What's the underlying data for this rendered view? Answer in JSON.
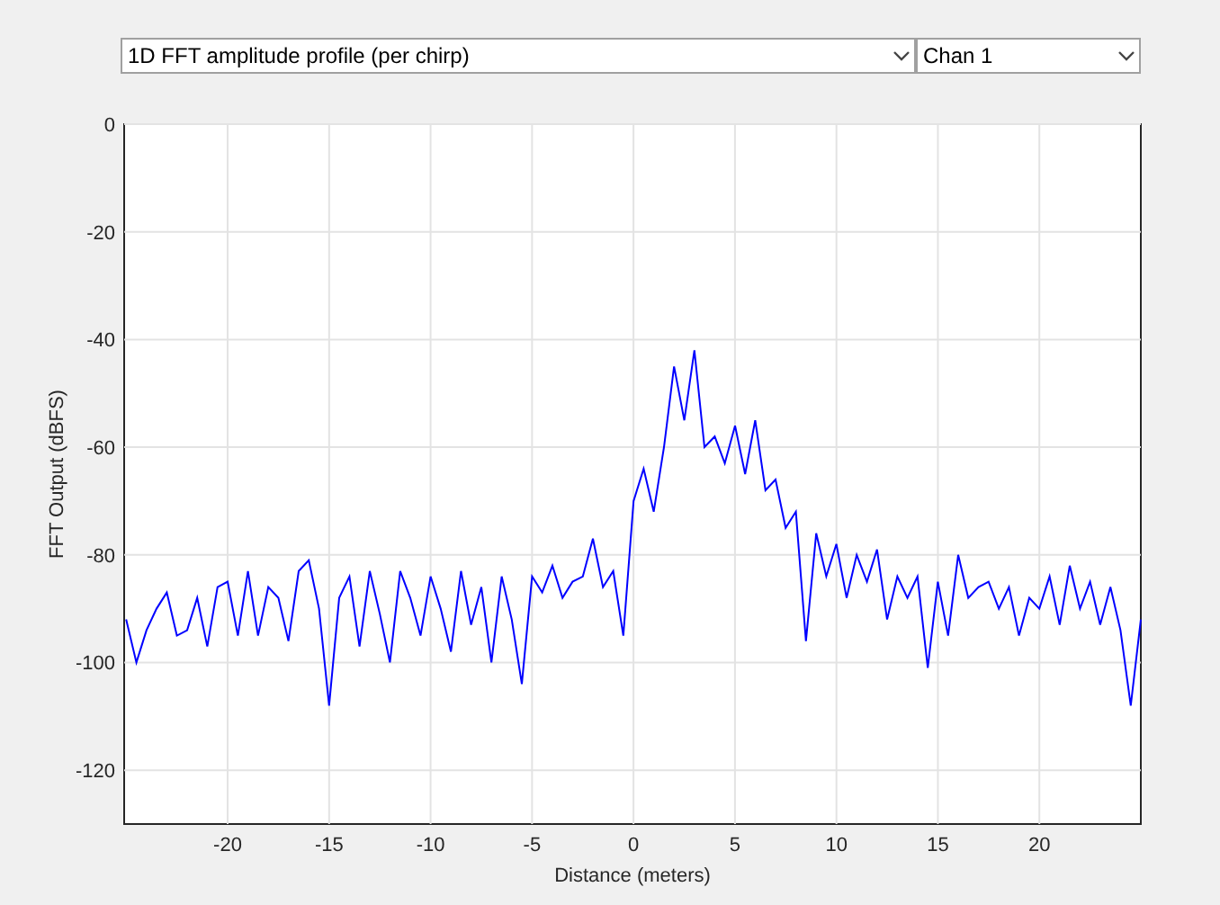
{
  "controls": {
    "plot_selector": {
      "value": "1D FFT amplitude profile (per chirp)"
    },
    "channel_selector": {
      "value": "Chan 1"
    }
  },
  "plot": {
    "chart_data": {
      "type": "line",
      "grid": true,
      "xlabel": "Distance (meters)",
      "ylabel": "FFT Output (dBFS)",
      "xlim": [
        -25.1,
        25
      ],
      "ylim": [
        -130,
        0
      ],
      "xticks": [
        -20,
        -15,
        -10,
        -5,
        0,
        5,
        10,
        15,
        20
      ],
      "yticks": [
        0,
        -20,
        -40,
        -60,
        -80,
        -100,
        -120
      ],
      "x": [
        -25,
        -24.5,
        -24,
        -23.5,
        -23,
        -22.5,
        -22,
        -21.5,
        -21,
        -20.5,
        -20,
        -19.5,
        -19,
        -18.5,
        -18,
        -17.5,
        -17,
        -16.5,
        -16,
        -15.5,
        -15,
        -14.5,
        -14,
        -13.5,
        -13,
        -12.5,
        -12,
        -11.5,
        -11,
        -10.5,
        -10,
        -9.5,
        -9,
        -8.5,
        -8,
        -7.5,
        -7,
        -6.5,
        -6,
        -5.5,
        -5,
        -4.5,
        -4,
        -3.5,
        -3,
        -2.5,
        -2,
        -1.5,
        -1,
        -0.5,
        0,
        0.5,
        1,
        1.5,
        2,
        2.5,
        3,
        3.5,
        4,
        4.5,
        5,
        5.5,
        6,
        6.5,
        7,
        7.5,
        8,
        8.5,
        9,
        9.5,
        10,
        10.5,
        11,
        11.5,
        12,
        12.5,
        13,
        13.5,
        14,
        14.5,
        15,
        15.5,
        16,
        16.5,
        17,
        17.5,
        18,
        18.5,
        19,
        19.5,
        20,
        20.5,
        21,
        21.5,
        22,
        22.5,
        23,
        23.5,
        24,
        24.5,
        25
      ],
      "series": [
        {
          "color": "#0000ff",
          "values": [
            -92,
            -100,
            -94,
            -90,
            -87,
            -95,
            -94,
            -88,
            -97,
            -86,
            -85,
            -95,
            -83,
            -95,
            -86,
            -88,
            -96,
            -83,
            -81,
            -90,
            -108,
            -88,
            -84,
            -97,
            -83,
            -91,
            -100,
            -83,
            -88,
            -95,
            -84,
            -90,
            -98,
            -83,
            -93,
            -86,
            -100,
            -84,
            -92,
            -104,
            -84,
            -87,
            -82,
            -88,
            -85,
            -84,
            -77,
            -86,
            -83,
            -95,
            -70,
            -64,
            -72,
            -60,
            -45,
            -55,
            -42,
            -60,
            -58,
            -63,
            -56,
            -65,
            -55,
            -68,
            -66,
            -75,
            -72,
            -96,
            -76,
            -84,
            -78,
            -88,
            -80,
            -85,
            -79,
            -92,
            -84,
            -88,
            -84,
            -101,
            -85,
            -95,
            -80,
            -88,
            -86,
            -85,
            -90,
            -86,
            -95,
            -88,
            -90,
            -84,
            -93,
            -82,
            -90,
            -85,
            -93,
            -86,
            -94,
            -108,
            -92
          ]
        }
      ]
    }
  }
}
